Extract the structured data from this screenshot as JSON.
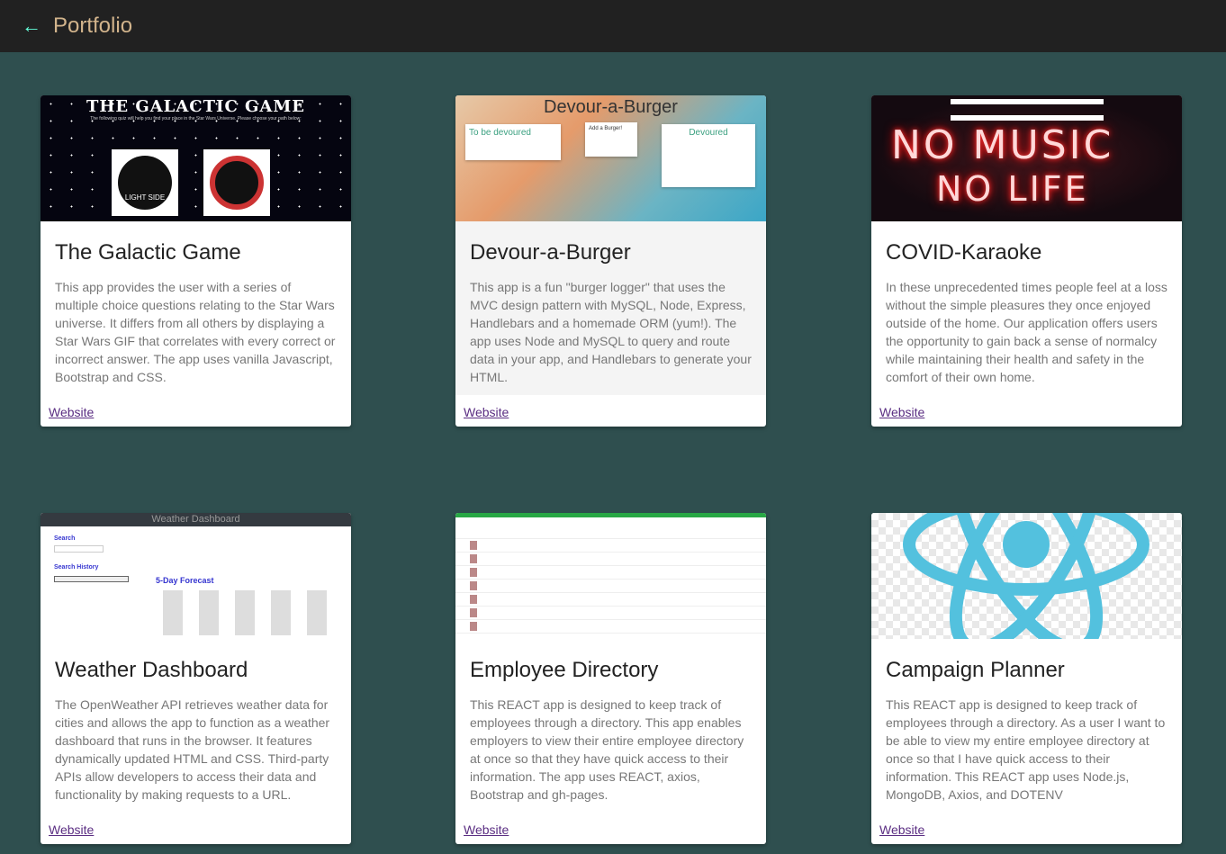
{
  "header": {
    "title": "Portfolio",
    "back_icon": "arrow-left-icon"
  },
  "colors": {
    "header_bg": "#212121",
    "page_bg": "#2f4f4f",
    "title": "#d2b48c",
    "back_arrow": "#64ffda"
  },
  "projects": [
    {
      "title": "The Galactic Game",
      "description": "This app provides the user with a series of multiple choice questions relating to the Star Wars universe. It differs from all others by displaying a Star Wars GIF that correlates with every correct or incorrect answer. The app uses vanilla Javascript, Bootstrap and CSS.",
      "link": "Website",
      "thumb": {
        "heading": "THE GALACTIC GAME",
        "sub": "The following quiz will help you find your place in the Star Wars Universe. Please choose your path below:",
        "light": "LIGHT SIDE"
      }
    },
    {
      "title": "Devour-a-Burger",
      "description": "This app is a fun \"burger logger\" that uses the MVC design pattern with MySQL, Node, Express, Handlebars and a homemade ORM (yum!). The app uses Node and MySQL to query and route data in your app, and Handlebars to generate your HTML.",
      "link": "Website",
      "thumb": {
        "heading": "Devour-a-Burger",
        "left": "To be devoured",
        "mid": "Add a Burger!",
        "right": "Devoured"
      }
    },
    {
      "title": "COVID-Karaoke",
      "description": "In these unprecedented times people feel at a loss without the simple pleasures they once enjoyed outside of the home. Our application offers users the opportunity to gain back a sense of normalcy while maintaining their health and safety in the comfort of their own home.",
      "link": "Website",
      "thumb": {
        "line1": "NO MUSIC",
        "line2": "NO LIFE"
      }
    },
    {
      "title": "Weather Dashboard",
      "description": "The OpenWeather API retrieves weather data for cities and allows the app to function as a weather dashboard that runs in the browser. It features dynamically updated HTML and CSS. Third-party APIs allow developers to access their data and functionality by making requests to a URL.",
      "link": "Website",
      "thumb": {
        "bar": "Weather Dashboard",
        "search": "Search",
        "history": "Search History",
        "forecast": "5-Day Forecast"
      }
    },
    {
      "title": "Employee Directory",
      "description": "This REACT app is designed to keep track of employees through a directory. This app enables employers to view their entire employee directory at once so that they have quick access to their information. The app uses REACT, axios, Bootstrap and gh-pages.",
      "link": "Website"
    },
    {
      "title": "Campaign Planner",
      "description": "This REACT app is designed to keep track of employees through a directory. As a user I want to be able to view my entire employee directory at once so that I have quick access to their information. This REACT app uses Node.js, MongoDB, Axios, and DOTENV",
      "link": "Website"
    }
  ]
}
